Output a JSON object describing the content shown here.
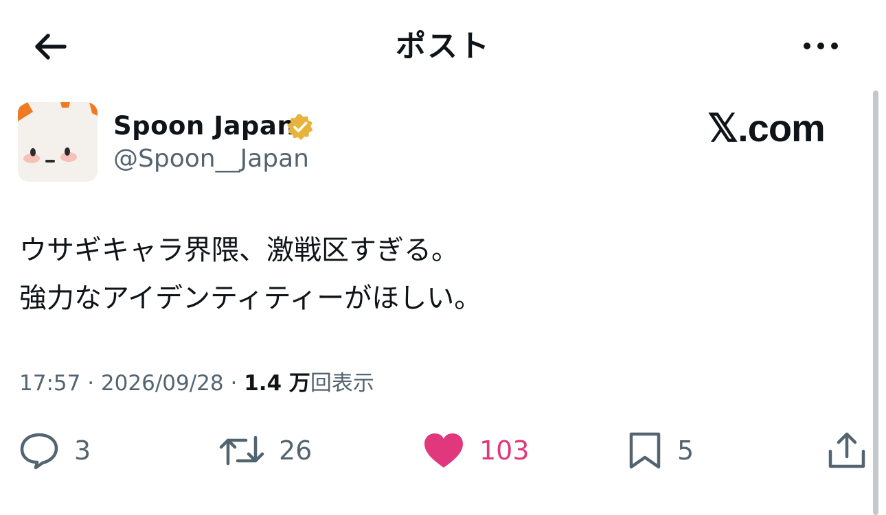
{
  "header": {
    "title": "ポスト",
    "back_icon": "arrow-left-icon",
    "more_icon": "more-dots-icon"
  },
  "author": {
    "name": "Spoon Japan",
    "handle": "@Spoon__Japan",
    "verified_color": "#e8b33c",
    "avatar_icon": "bunny-character-icon"
  },
  "brand": {
    "text": "𝕏.com"
  },
  "tweet": {
    "lines": [
      "ウサギキャラ界隈、激戦区すぎる。",
      "強力なアイデンティティーがほしい。"
    ]
  },
  "meta": {
    "time": "17:57",
    "sep": "·",
    "date": "2026/09/28",
    "views_count": "1.4 万",
    "views_label": "回表示"
  },
  "actions": {
    "reply": "3",
    "repost": "26",
    "like": "103",
    "bookmark": "5",
    "like_color": "#e0377d",
    "muted_color": "#536471"
  }
}
